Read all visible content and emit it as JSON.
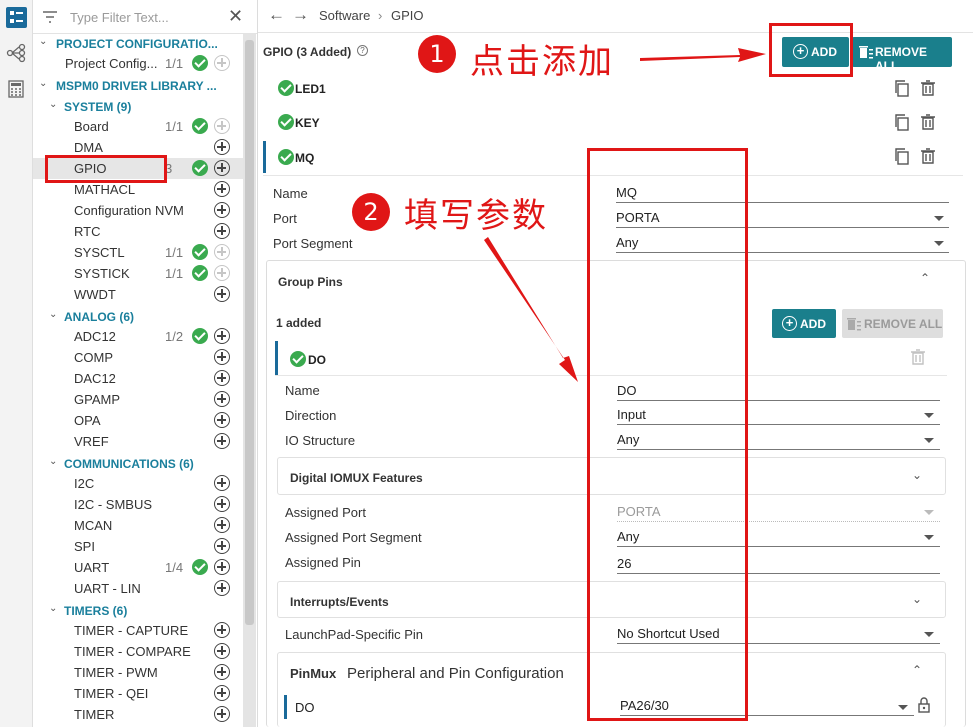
{
  "filter": {
    "placeholder": "Type Filter Text..."
  },
  "tree": {
    "groups": [
      {
        "label": "PROJECT CONFIGURATIO..."
      },
      {
        "label": "MSPM0 DRIVER LIBRARY ..."
      },
      {
        "label": "SYSTEM (9)"
      },
      {
        "label": "ANALOG (6)"
      },
      {
        "label": "COMMUNICATIONS (6)"
      },
      {
        "label": "TIMERS (6)"
      }
    ],
    "items": [
      {
        "label": "Project Config...",
        "count": "1/1"
      },
      {
        "label": "Board",
        "count": "1/1"
      },
      {
        "label": "DMA",
        "count": ""
      },
      {
        "label": "GPIO",
        "count": "3"
      },
      {
        "label": "MATHACL",
        "count": ""
      },
      {
        "label": "Configuration NVM",
        "count": ""
      },
      {
        "label": "RTC",
        "count": ""
      },
      {
        "label": "SYSCTL",
        "count": "1/1"
      },
      {
        "label": "SYSTICK",
        "count": "1/1"
      },
      {
        "label": "WWDT",
        "count": ""
      },
      {
        "label": "ADC12",
        "count": "1/2"
      },
      {
        "label": "COMP",
        "count": ""
      },
      {
        "label": "DAC12",
        "count": ""
      },
      {
        "label": "GPAMP",
        "count": ""
      },
      {
        "label": "OPA",
        "count": ""
      },
      {
        "label": "VREF",
        "count": ""
      },
      {
        "label": "I2C",
        "count": ""
      },
      {
        "label": "I2C - SMBUS",
        "count": ""
      },
      {
        "label": "MCAN",
        "count": ""
      },
      {
        "label": "SPI",
        "count": ""
      },
      {
        "label": "UART",
        "count": "1/4"
      },
      {
        "label": "UART - LIN",
        "count": ""
      },
      {
        "label": "TIMER - CAPTURE",
        "count": ""
      },
      {
        "label": "TIMER - COMPARE",
        "count": ""
      },
      {
        "label": "TIMER - PWM",
        "count": ""
      },
      {
        "label": "TIMER - QEI",
        "count": ""
      },
      {
        "label": "TIMER",
        "count": ""
      }
    ]
  },
  "breadcrumb": {
    "root": "Software",
    "sep": "›",
    "current": "GPIO"
  },
  "main": {
    "title": "GPIO (3 Added)",
    "add_label": "ADD",
    "remove_all_label": "REMOVE ALL",
    "instances": [
      "LED1",
      "KEY",
      "MQ"
    ],
    "fields": {
      "name_label": "Name",
      "name_value": "MQ",
      "port_label": "Port",
      "port_value": "PORTA",
      "segment_label": "Port Segment",
      "segment_value": "Any"
    },
    "group_pins": {
      "title": "Group Pins",
      "added": "1 added",
      "add_label": "ADD",
      "remove_all_label": "REMOVE ALL",
      "pin": "DO",
      "name_label": "Name",
      "name_value": "DO",
      "direction_label": "Direction",
      "direction_value": "Input",
      "io_label": "IO Structure",
      "io_value": "Any",
      "digital_iomux": "Digital IOMUX Features",
      "assigned_port_label": "Assigned Port",
      "assigned_port_value": "PORTA",
      "assigned_segment_label": "Assigned Port Segment",
      "assigned_segment_value": "Any",
      "assigned_pin_label": "Assigned Pin",
      "assigned_pin_value": "26",
      "interrupts": "Interrupts/Events",
      "launchpad_label": "LaunchPad-Specific Pin",
      "launchpad_value": "No Shortcut Used",
      "pinmux_bold": "PinMux",
      "pinmux_title": "Peripheral and Pin Configuration",
      "pinmux_pin": "DO",
      "pinmux_value": "PA26/30"
    }
  },
  "annotations": {
    "step1_num": "1",
    "step1_text": "点击添加",
    "step2_num": "2",
    "step2_text": "填写参数"
  },
  "colors": {
    "accent": "#1a7f8c",
    "check": "#3aaa4f",
    "annotation": "#e01616",
    "group": "#1a7f9c"
  }
}
